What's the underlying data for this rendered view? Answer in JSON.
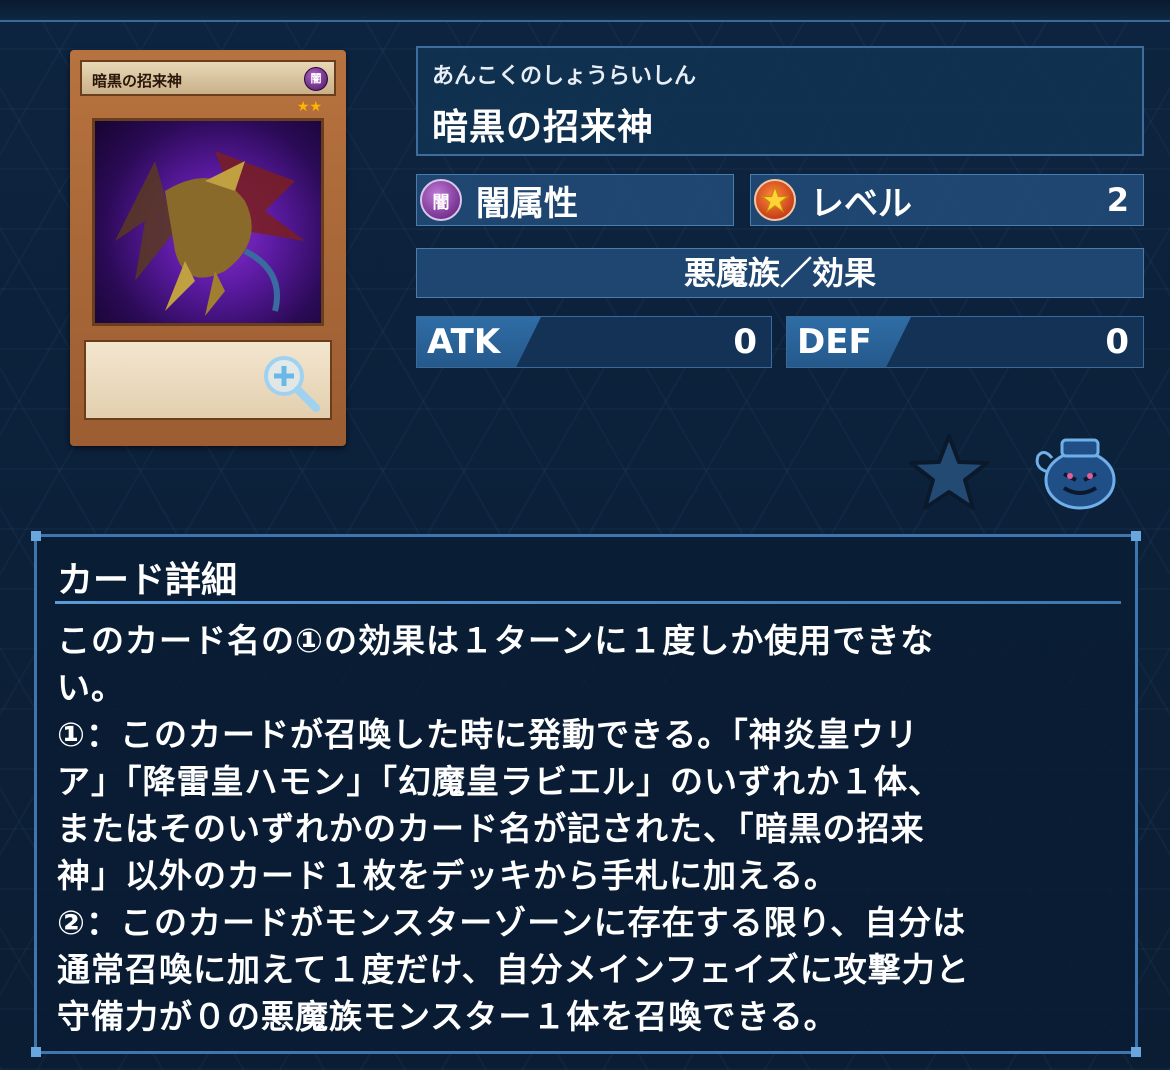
{
  "card": {
    "image_name": "暗黒の招来神",
    "attribute_mini": "闇",
    "stars": "★★",
    "zoom_icon": "zoom-in-icon"
  },
  "header": {
    "furigana": "あんこくのしょうらいしん",
    "name": "暗黒の招来神"
  },
  "attribute": {
    "icon": "dark-attribute-icon",
    "icon_text": "闇",
    "label": "闇属性"
  },
  "level": {
    "icon": "level-star-icon",
    "label": "レベル",
    "value": "2"
  },
  "type_line": "悪魔族／効果",
  "atk": {
    "label": "ATK",
    "value": "0"
  },
  "def": {
    "label": "DEF",
    "value": "0"
  },
  "actions": {
    "favorite_icon": "star-icon",
    "pot_icon": "pot-of-greed-icon"
  },
  "details": {
    "title": "カード詳細",
    "lines": [
      "このカード名の①の効果は１ターンに１度しか使用できな",
      "い。",
      "①：このカードが召喚した時に発動できる。「神炎皇ウリ",
      "ア」「降雷皇ハモン」「幻魔皇ラビエル」のいずれか１体、",
      "またはそのいずれかのカード名が記された、「暗黒の招来",
      "神」以外のカード１枚をデッキから手札に加える。",
      "②：このカードがモンスターゾーンに存在する限り、自分は",
      "通常召喚に加えて１度だけ、自分メインフェイズに攻撃力と",
      "守備力が０の悪魔族モンスター１体を召喚できる。"
    ]
  },
  "colors": {
    "accent": "#3e77b0",
    "panel": "#204a76",
    "background": "#0c2038"
  }
}
